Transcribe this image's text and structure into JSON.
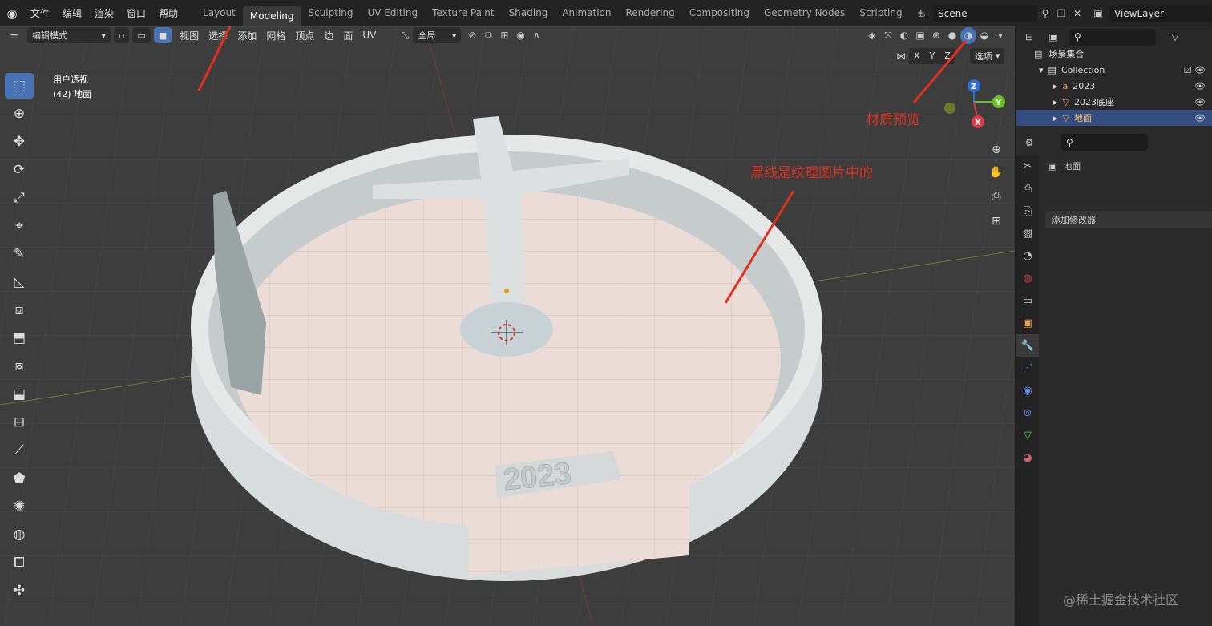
{
  "topbar": {
    "menu": [
      "文件",
      "编辑",
      "渲染",
      "窗口",
      "帮助"
    ],
    "workspaces": [
      "Layout",
      "Modeling",
      "Sculpting",
      "UV Editing",
      "Texture Paint",
      "Shading",
      "Animation",
      "Rendering",
      "Compositing",
      "Geometry Nodes",
      "Scripting"
    ],
    "active_workspace": "Modeling",
    "add_workspace": "+",
    "scene": "Scene",
    "view_layer": "ViewLayer"
  },
  "viewport_header": {
    "mode": "编辑模式",
    "menus": [
      "视图",
      "选择",
      "添加",
      "网格",
      "顶点",
      "边",
      "面",
      "UV"
    ],
    "transform_orientation": "全局",
    "axes": [
      "X",
      "Y",
      "Z"
    ],
    "options": "选项"
  },
  "viewport": {
    "view_name": "用户透视",
    "object_info": "(42) 地面",
    "floor_text": "2023",
    "gizmo_axes": {
      "z": "Z",
      "y": "Y",
      "x": "X"
    }
  },
  "annotations": {
    "material_preview": "材质预览",
    "texture_note": "黑线是纹理图片中的"
  },
  "outliner": {
    "root": "场景集合",
    "collection": "Collection",
    "items": [
      {
        "name": "2023",
        "selected": false
      },
      {
        "name": "2023底座",
        "selected": false
      },
      {
        "name": "地面",
        "selected": true
      }
    ]
  },
  "properties": {
    "object_name": "地面",
    "add_modifier": "添加修改器"
  },
  "watermark": "@稀土掘金技术社区",
  "colors": {
    "accent": "#4772b3",
    "annotation": "#e0301e",
    "viewport_bg": "#3d3d3d",
    "panel_bg": "#2b2b2b"
  }
}
